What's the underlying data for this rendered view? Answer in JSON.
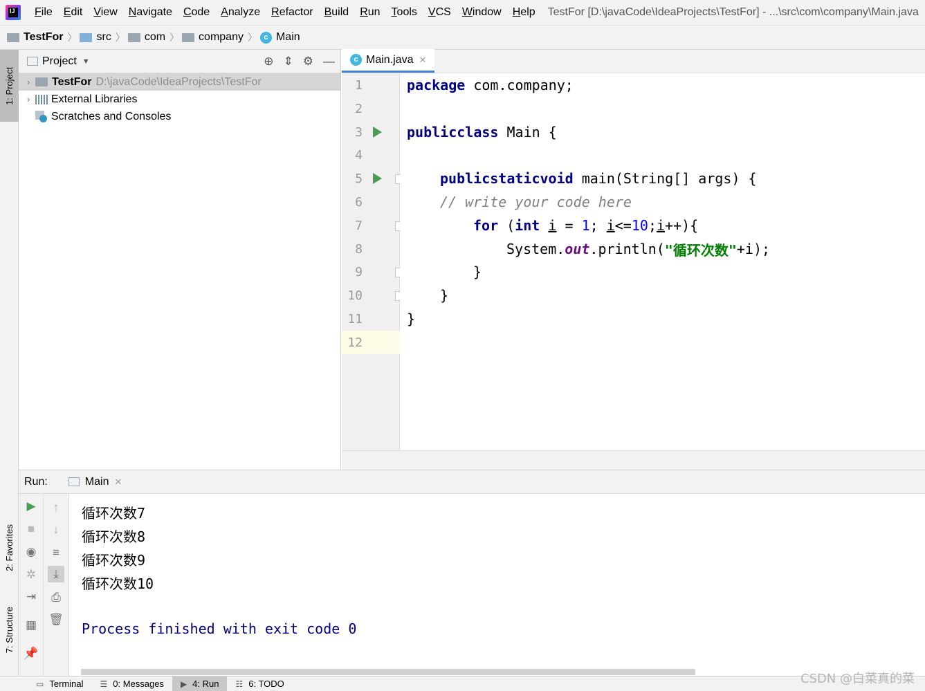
{
  "menubar": {
    "items": [
      "File",
      "Edit",
      "View",
      "Navigate",
      "Code",
      "Analyze",
      "Refactor",
      "Build",
      "Run",
      "Tools",
      "VCS",
      "Window",
      "Help"
    ],
    "window_title": "TestFor [D:\\javaCode\\IdeaProjects\\TestFor] - ...\\src\\com\\company\\Main.java"
  },
  "breadcrumb": [
    "TestFor",
    "src",
    "com",
    "company",
    "Main"
  ],
  "left_stripe": {
    "project_tab": "1: Project",
    "favorites_tab": "2: Favorites",
    "structure_tab": "7: Structure"
  },
  "project_panel": {
    "title": "Project",
    "tree": [
      {
        "label": "TestFor",
        "path": "D:\\javaCode\\IdeaProjects\\TestFor"
      },
      {
        "label": "External Libraries"
      },
      {
        "label": "Scratches and Consoles"
      }
    ]
  },
  "editor": {
    "tab_label": "Main.java",
    "line_numbers": [
      "1",
      "2",
      "3",
      "4",
      "5",
      "6",
      "7",
      "8",
      "9",
      "10",
      "11",
      "12"
    ],
    "code": {
      "l1_kw": "package",
      "l1_rest": " com.company;",
      "l3_kw1": "public",
      "l3_kw2": "class",
      "l3_rest": " Main {",
      "l5_kw1": "public",
      "l5_kw2": "static",
      "l5_kw3": "void",
      "l5_rest": " main(String[] args) {",
      "l6_comment": "// write your code here",
      "l7_kw1": "for",
      "l7_a": " (",
      "l7_kw2": "int",
      "l7_b": " ",
      "l7_i1": "i",
      "l7_c": " = ",
      "l7_n1": "1",
      "l7_d": "; ",
      "l7_i2": "i",
      "l7_e": "<=",
      "l7_n2": "10",
      "l7_f": ";",
      "l7_i3": "i",
      "l7_g": "++){",
      "l8_a": "System.",
      "l8_field": "out",
      "l8_b": ".println(",
      "l8_str": "\"循环次数\"",
      "l8_c": "+i);",
      "l9": "}",
      "l10": "}",
      "l11": "}"
    }
  },
  "run_panel": {
    "label": "Run:",
    "tab_label": "Main",
    "output": [
      "循环次数7",
      "循环次数8",
      "循环次数9",
      "循环次数10",
      "",
      "Process finished with exit code 0"
    ]
  },
  "bottombar": [
    "Terminal",
    "0: Messages",
    "4: Run",
    "6: TODO"
  ],
  "watermark": "CSDN @白菜真的菜"
}
